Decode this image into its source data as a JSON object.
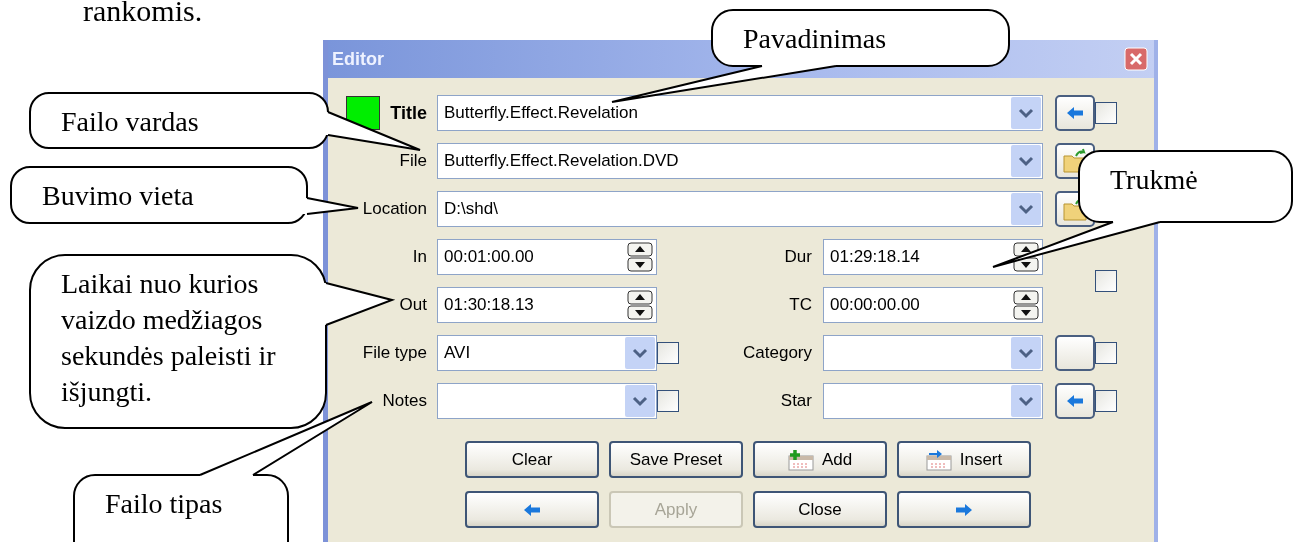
{
  "document_text": "rankomis.",
  "window": {
    "title": "Editor"
  },
  "fields": [
    {
      "label": "Title",
      "bold": true,
      "color": "#00ee00",
      "value": "Butterfly.Effect.Revelation",
      "side_button": {
        "kind": "arrow-left"
      },
      "checked": false
    },
    {
      "label": "File",
      "bold": false,
      "value": "Butterfly.Effect.Revelation.DVD",
      "side_button": {
        "kind": "folder"
      }
    },
    {
      "label": "Location",
      "bold": false,
      "value": "D:\\shd\\",
      "side_button": {
        "kind": "folder"
      }
    }
  ],
  "time_rows": [
    {
      "left": {
        "label": "In",
        "value": "00:01:00.00"
      },
      "right": {
        "label": "Dur",
        "value": "01:29:18.14"
      }
    },
    {
      "left": {
        "label": "Out",
        "value": "01:30:18.13"
      },
      "right": {
        "label": "TC",
        "value": "00:00:00.00"
      }
    }
  ],
  "time_checked": false,
  "pair_rows": [
    {
      "left": {
        "label": "File type",
        "value": "AVI",
        "checked": false
      },
      "right": {
        "label": "Category",
        "side_button": {
          "kind": "blank"
        },
        "checked": false
      }
    },
    {
      "left": {
        "label": "Notes",
        "checked": false
      },
      "right": {
        "label": "Star",
        "side_button": {
          "kind": "arrow-left"
        },
        "checked": false
      }
    }
  ],
  "buttons": [
    {
      "kind": "text",
      "label": "Clear",
      "disabled": false
    },
    {
      "kind": "text",
      "label": "Save Preset",
      "disabled": false
    },
    {
      "kind": "add",
      "label": "Add",
      "disabled": false
    },
    {
      "kind": "insert",
      "label": "Insert",
      "disabled": false
    },
    {
      "kind": "prev",
      "disabled": false
    },
    {
      "kind": "text",
      "label": "Apply",
      "disabled": true
    },
    {
      "kind": "text",
      "label": "Close",
      "disabled": false
    },
    {
      "kind": "next",
      "disabled": false
    }
  ],
  "callouts": [
    {
      "text": "Pavadinimas"
    },
    {
      "text": "Failo vardas"
    },
    {
      "text": "Buvimo vieta"
    },
    {
      "text": "Laikai nuo kurios vaizdo medžiagos sekundės paleisti ir išjungti."
    },
    {
      "text": "Trukmė"
    },
    {
      "text": "Failo tipas"
    }
  ]
}
